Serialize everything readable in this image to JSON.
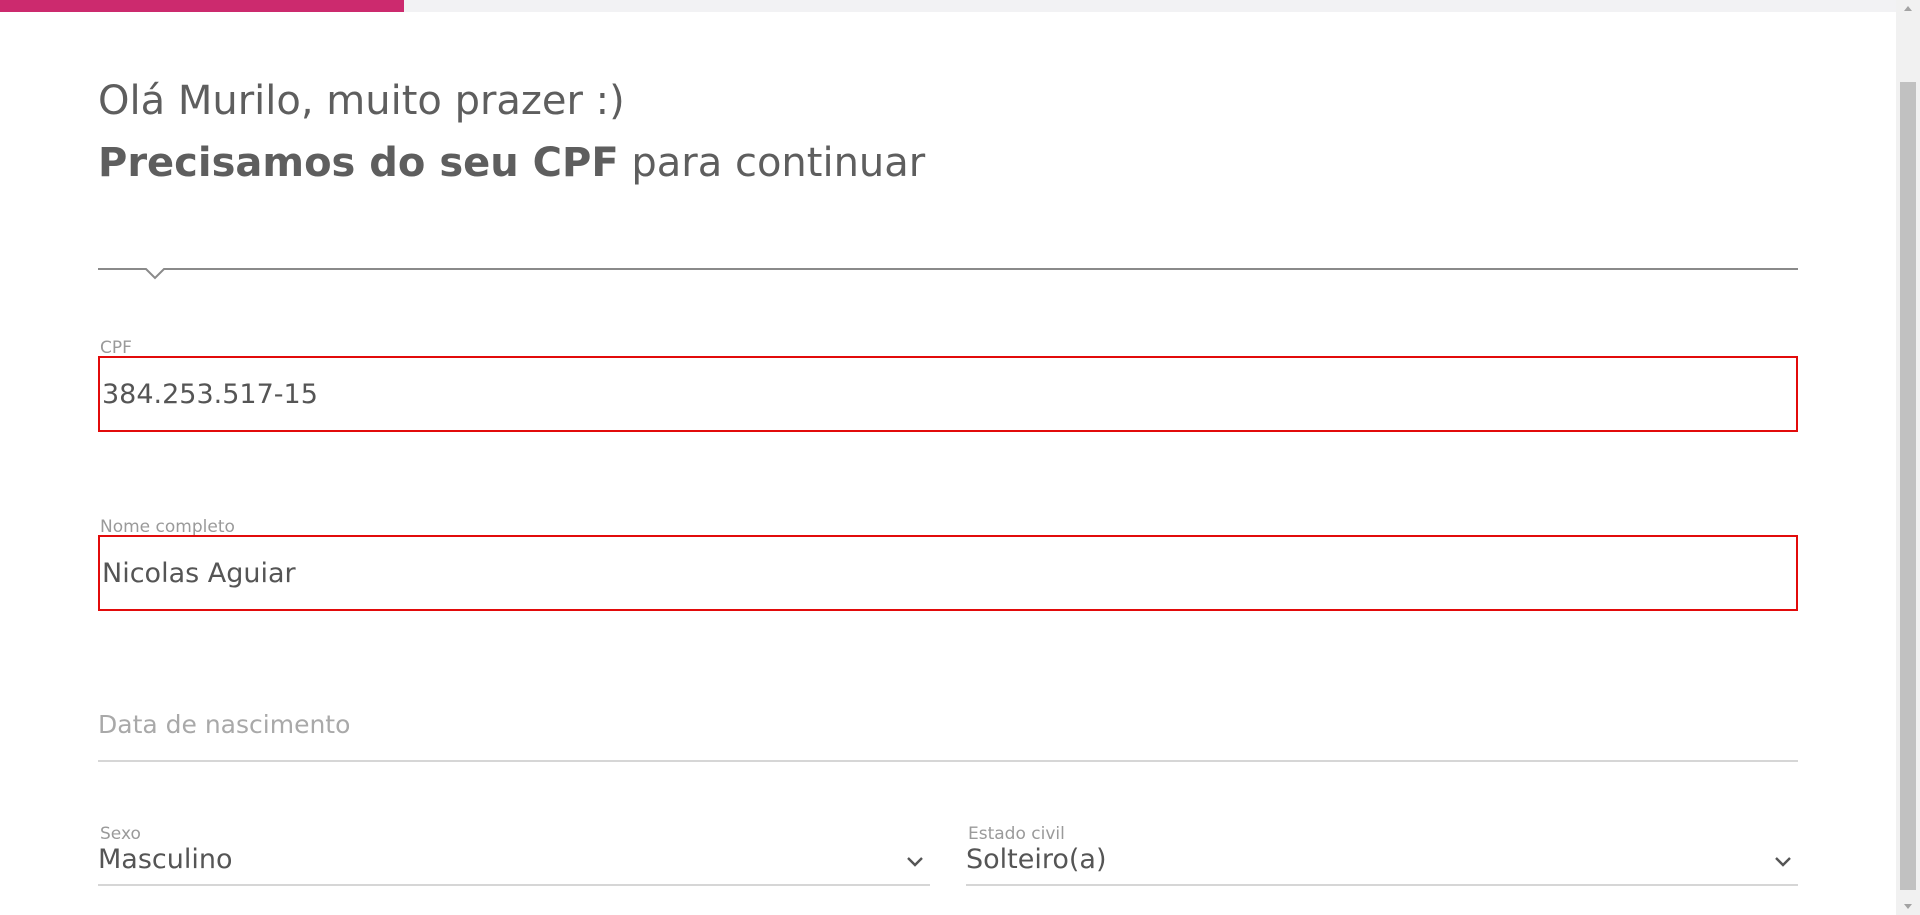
{
  "progress": {
    "fraction": 0.2105,
    "color": "#cc2a6e"
  },
  "header": {
    "greeting": "Olá Murilo, muito prazer :)",
    "headline_bold": "Precisamos do seu CPF",
    "headline_rest": " para continuar"
  },
  "form": {
    "cpf": {
      "label": "CPF",
      "value": "384.253.517-15"
    },
    "full_name": {
      "label": "Nome completo",
      "value": "Nicolas Aguiar"
    },
    "birth_date": {
      "placeholder": "Data de nascimento"
    },
    "sex": {
      "label": "Sexo",
      "value": "Masculino"
    },
    "marital_status": {
      "label": "Estado civil",
      "value": "Solteiro(a)"
    }
  },
  "colors": {
    "accent": "#cc2a6e",
    "error_border": "#e20b0b",
    "text": "#5e5e5e",
    "muted": "#9a9a9a"
  },
  "icons": {
    "sex_dropdown": "chevron-down-icon",
    "marital_dropdown": "chevron-down-icon",
    "scroll_up": "triangle-up-icon",
    "scroll_down": "triangle-down-icon"
  }
}
